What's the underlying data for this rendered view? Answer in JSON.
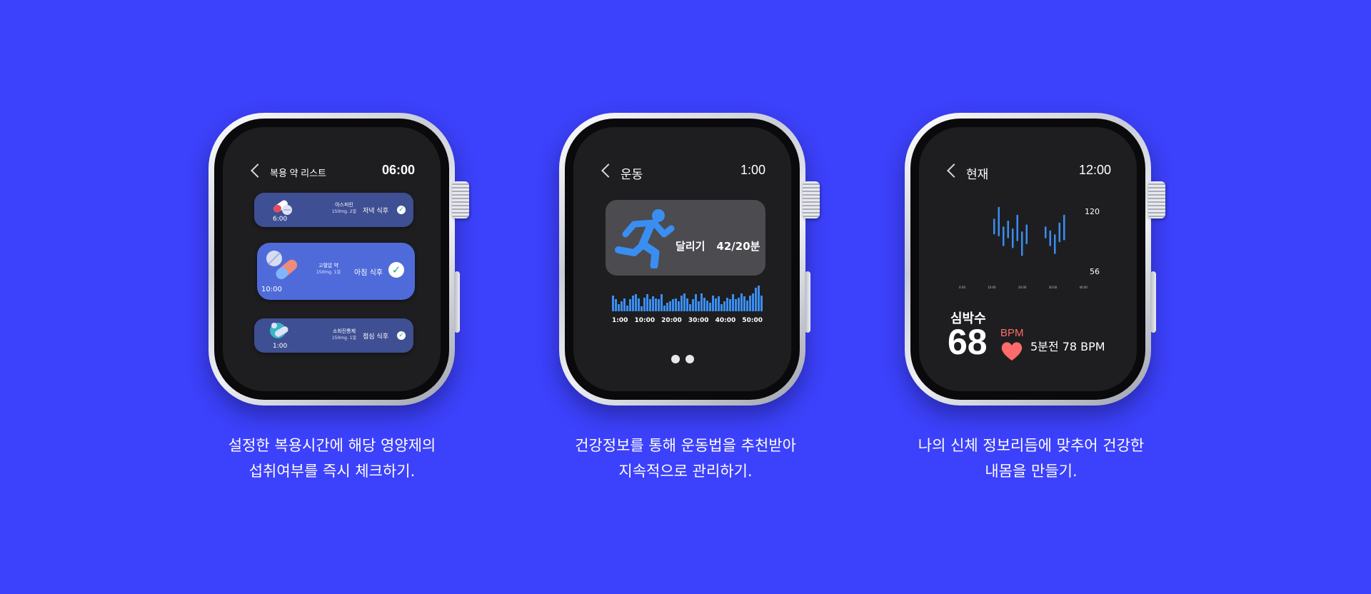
{
  "watches": [
    {
      "title": "복용 약 리스트",
      "time": "06:00",
      "cards": [
        {
          "time": "6:00",
          "name": "아스피린",
          "dose": "150mg. 2알",
          "when": "저녁 식후",
          "checked": true
        },
        {
          "time": "10:00",
          "name": "고혈압 약",
          "dose": "150mg. 1알",
          "when": "아침 식후",
          "checked": true
        },
        {
          "time": "1:00",
          "name": "소화진통제",
          "dose": "150mg. 1알",
          "when": "점심 식후",
          "checked": true
        }
      ]
    },
    {
      "title": "운동",
      "time": "1:00",
      "activity": "달리기",
      "activity_value": "42/20분",
      "chart_data": {
        "type": "bar",
        "x_ticks": [
          "1:00",
          "10:00",
          "20:00",
          "30:00",
          "40:00",
          "50:00"
        ],
        "values": [
          16,
          12,
          7,
          10,
          13,
          6,
          12,
          16,
          17,
          13,
          5,
          14,
          17,
          12,
          15,
          13,
          12,
          17,
          6,
          9,
          10,
          12,
          13,
          10,
          16,
          18,
          13,
          7,
          12,
          17,
          10,
          18,
          14,
          11,
          9,
          16,
          13,
          15,
          7,
          10,
          14,
          12,
          17,
          12,
          14,
          18,
          15,
          11,
          16,
          18,
          24,
          26,
          16
        ]
      },
      "page_dots": 2
    },
    {
      "title": "현재",
      "time": "12:00",
      "chart_data": {
        "type": "bar",
        "y_max_label": "120",
        "y_min_label": "56",
        "x_ticks": [
          "0:00",
          "10:00",
          "20:00",
          "30:00",
          "40:00"
        ],
        "ranges": [
          [
            92,
            108
          ],
          [
            90,
            120
          ],
          [
            80,
            100
          ],
          [
            88,
            106
          ],
          [
            78,
            98
          ],
          [
            85,
            112
          ],
          [
            70,
            95
          ],
          [
            82,
            102
          ],
          [
            88,
            100
          ],
          [
            80,
            96
          ],
          [
            72,
            92
          ],
          [
            84,
            104
          ],
          [
            86,
            112
          ]
        ]
      },
      "heart_label": "심박수",
      "heart_value": "68",
      "heart_unit": "BPM",
      "previous": "5분전 78 BPM"
    }
  ],
  "captions": [
    [
      "설정한 복용시간에 해당 영양제의",
      "섭취여부를 즉시 체크하기."
    ],
    [
      "건강정보를 통해 운동법을 추천받아",
      "지속적으로 관리하기."
    ],
    [
      "나의 신체 정보리듬에 맞추어 건강한",
      "내몸을 만들기."
    ]
  ],
  "colors": {
    "background": "#3c41fb",
    "card": "#3f4f93",
    "card_highlight": "#4f6bd9",
    "bar": "#3a8ef1",
    "heart": "#ff6b6b"
  }
}
